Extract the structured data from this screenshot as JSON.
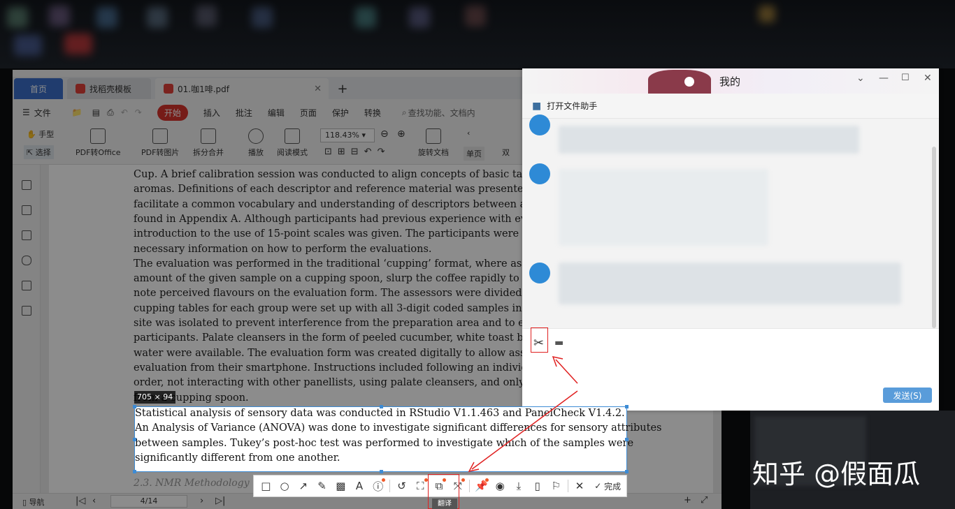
{
  "wps": {
    "tabs": [
      {
        "label": "首页"
      },
      {
        "label": "找稻壳模板"
      },
      {
        "label": "01.咖1啡.pdf"
      }
    ],
    "menu": [
      "文件",
      "开始",
      "插入",
      "批注",
      "编辑",
      "页面",
      "保护",
      "转换"
    ],
    "search_placeholder": "查找功能、文档内",
    "ribbon": {
      "hand": "手型",
      "select": "选择",
      "pdf_to_office": "PDF转Office",
      "pdf_to_image": "PDF转图片",
      "split_merge": "拆分合并",
      "play": "播放",
      "read_mode": "阅读模式",
      "zoom": "118.43%",
      "rotate_doc": "旋转文档",
      "single_page": "单页",
      "double_page": "双"
    },
    "status": {
      "nav": "导航",
      "page": "4/14"
    }
  },
  "document": {
    "lines_top": [
      "Cup.  A brief calibration session was conducted to align concepts of basic ta",
      "aromas. Definitions of each descriptor and reference material was presented t",
      "facilitate a common vocabulary and understanding of descriptors between as",
      "found in Appendix A. Although participants had previous experience with evalu",
      "introduction to the use of 15-point scales was given. The participants were blinde",
      "necessary information on how to perform the evaluations.",
      "     The evaluation was performed in the traditional ‘cupping’ format, where as",
      "amount of the given sample on a cupping spoon, slurp the coffee rapidly to aerate",
      "note perceived flavours on the evaluation form.  The assessors were divided",
      "cupping tables for each group were set up with all 3-digit coded samples in thre",
      "site was isolated to prevent interference from the preparation area and to en",
      "participants. Palate cleansers in the form of peeled cucumber, white toast bread, an",
      "water were available.  The evaluation form was created digitally to allow asse",
      "evaluation from their smartphone. Instructions included following an individually",
      "order, not interacting with other panellists, using palate cleansers, and only tasting",
      "      from a cupping spoon."
    ],
    "selected_lines": [
      "     Statistical analysis of sensory data was conducted in RStudio V1.1.463 and PanelCheck V1.4.2.",
      "An Analysis of Variance (ANOVA) was done to investigate significant differences for sensory attributes",
      "between samples.  Tukey’s post-hoc test was performed to investigate which of the samples were",
      "significantly different from one another."
    ],
    "next_heading": "2.3. NMR Methodology"
  },
  "snapshot": {
    "size_label": "705 × 94",
    "done_label": "完成",
    "translate_tip": "翻译",
    "tools": [
      "rect-icon",
      "ellipse-icon",
      "arrow-icon",
      "pen-icon",
      "mosaic-icon",
      "text-icon",
      "number-icon",
      "undo-icon",
      "ocr-icon",
      "translate-icon",
      "expand-icon",
      "pin-icon",
      "record-icon",
      "download-icon",
      "phone-icon",
      "bookmark-icon"
    ]
  },
  "chat": {
    "title": "我的",
    "open_file_assistant": "打开文件助手",
    "send_label": "发送(S)"
  },
  "watermark": "知乎 @假面瓜",
  "colors": {
    "accent_blue": "#3d8bd4",
    "wps_red": "#d8342c",
    "highlight_red": "#e02020"
  }
}
